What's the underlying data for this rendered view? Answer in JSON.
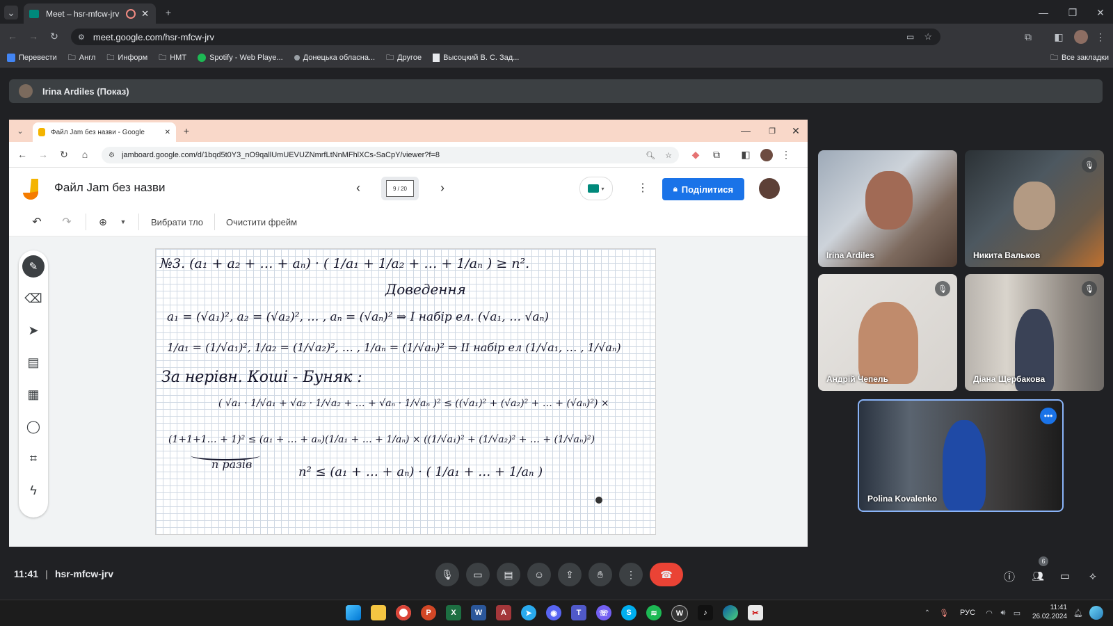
{
  "browser": {
    "tab_title": "Meet – hsr-mfcw-jrv",
    "url": "meet.google.com/hsr-mfcw-jrv",
    "bookmarks": [
      "Перевести",
      "Англ",
      "Информ",
      "НМТ",
      "Spotify - Web Playe...",
      "Донецька обласна...",
      "Другое",
      "Высоцкий В. С. Зад..."
    ],
    "all_bookmarks": "Все закладки"
  },
  "meet": {
    "presenter_label": "Irina Ardiles (Показ)",
    "time": "11:41",
    "separator": "|",
    "meeting_code": "hsr-mfcw-jrv",
    "participant_count": "6"
  },
  "shared": {
    "tab_title": "Файл Jam без назви - Google",
    "url": "jamboard.google.com/d/1bqd5t0Y3_nO9qallUmUEVUZNmrfLtNnMFhlXCs-SaCpY/viewer?f=8",
    "doc_title": "Файл Jam без назви",
    "frame_counter": "9 / 20",
    "share_label": "Поділитися",
    "set_background": "Вибрати тло",
    "clear_frame": "Очистити фрейм",
    "handwriting": {
      "l1": "№3.  (a₁ + a₂ + … + aₙ) · ( 1/a₁ + 1/a₂ + … + 1/aₙ ) ≥ n².",
      "l2": "Доведення",
      "l3": "a₁ = (√a₁)²,  a₂ = (√a₂)², … , aₙ = (√aₙ)²  ⇒ I набір ел. (√a₁, … √aₙ)",
      "l4": "1/a₁ = (1/√a₁)²,  1/a₂ = (1/√a₂)², … , 1/aₙ = (1/√aₙ)²  ⇒ II набір ел (1/√a₁, … , 1/√aₙ)",
      "l5": "За нерівн. Коші - Буняк :",
      "l6": "( √a₁ · 1/√a₁ + √a₂ · 1/√a₂ + … + √aₙ · 1/√aₙ )² ≤ ((√a₁)² + (√a₂)² + … + (√aₙ)²) ×",
      "l7": "(1+1+1… + 1)² ≤ (a₁ + … + aₙ)(1/a₁ + … + 1/aₙ)   × ((1/√a₁)² + (1/√a₂)² + … + (1/√aₙ)²)",
      "l8": "n разів",
      "l9": "n² ≤ (a₁ + … + aₙ) · ( 1/a₁ + … + 1/aₙ )"
    }
  },
  "participants": [
    {
      "name": "Irina Ardiles",
      "muted": false
    },
    {
      "name": "Никита Вальков",
      "muted": true
    },
    {
      "name": "Андрій Чепель",
      "muted": true
    },
    {
      "name": "Діана Щербакова",
      "muted": true
    },
    {
      "name": "Polina Kovalenko",
      "muted": false
    }
  ],
  "taskbar": {
    "lang": "РУС",
    "time": "11:41",
    "date": "26.02.2024"
  },
  "colors": {
    "accent_blue": "#1a73e8",
    "end_call_red": "#ea4335",
    "meet_bg": "#202124",
    "jam_tabstrip": "#f9d8c9"
  }
}
